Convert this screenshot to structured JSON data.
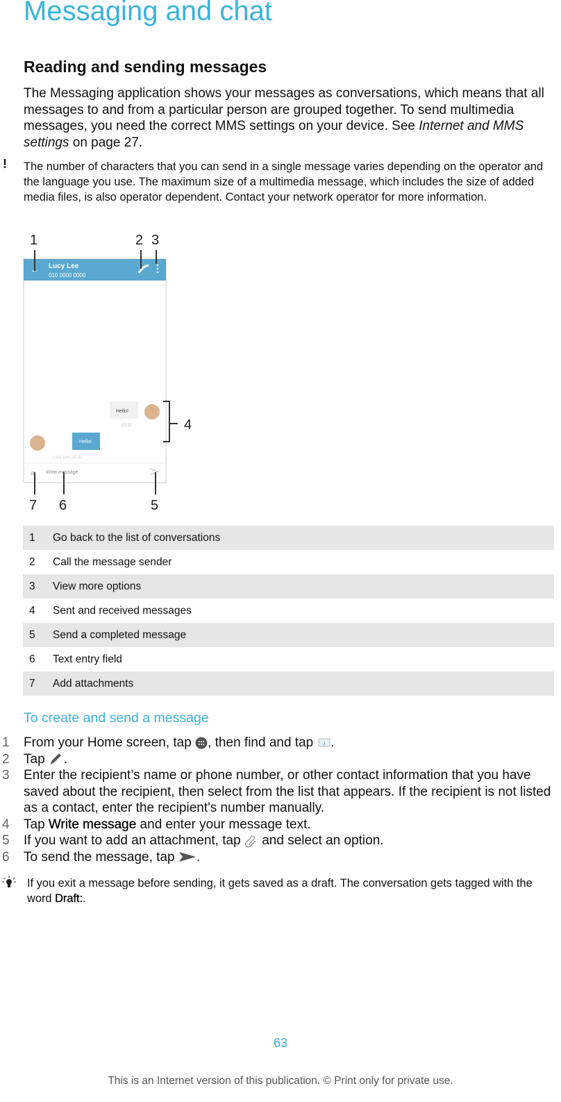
{
  "title": "Messaging and chat",
  "section": "Reading and sending messages",
  "intro": {
    "text1": "The Messaging application shows your messages as conversations, which means that all messages to and from a particular person are grouped together. To send multimedia messages, you need the correct MMS settings on your device. See ",
    "link": "Internet and MMS settings",
    "text2": " on page 27."
  },
  "note": "The number of characters that you can send in a single message varies depending on the operator and the language you use. The maximum size of a multimedia message, which includes the size of added media files, is also operator dependent. Contact your network operator for more information.",
  "figure": {
    "contact_name": "Lucy Lee",
    "contact_number": "010 0000 0000",
    "sent": "Hello!",
    "sent_time": "10:32",
    "received": "Hello!",
    "received_meta": "Lucy Lee, 10:32",
    "input_placeholder": "Write message",
    "callouts": [
      "1",
      "2",
      "3",
      "4",
      "5",
      "6",
      "7"
    ],
    "accent": "#5aa8cf"
  },
  "legend": [
    {
      "n": "1",
      "text": "Go back to the list of conversations"
    },
    {
      "n": "2",
      "text": "Call the message sender"
    },
    {
      "n": "3",
      "text": "View more options"
    },
    {
      "n": "4",
      "text": "Sent and received messages"
    },
    {
      "n": "5",
      "text": "Send a completed message"
    },
    {
      "n": "6",
      "text": "Text entry field"
    },
    {
      "n": "7",
      "text": "Add attachments"
    }
  ],
  "procedure": {
    "heading": "To create and send a message",
    "steps": [
      {
        "n": "1",
        "a": "From your Home screen, tap ",
        "b": ", then find and tap ",
        "c": "."
      },
      {
        "n": "2",
        "a": "Tap ",
        "c": "."
      },
      {
        "n": "3",
        "a": "Enter the recipient’s name or phone number, or other contact information that you have saved about the recipient, then select from the list that appears. If the recipient is not listed as a contact, enter the recipient's number manually."
      },
      {
        "n": "4",
        "a": "Tap ",
        "ui": "Write message",
        "c": " and enter your message text."
      },
      {
        "n": "5",
        "a": "If you want to add an attachment, tap ",
        "c": " and select an option."
      },
      {
        "n": "6",
        "a": "To send the message, tap ",
        "c": "."
      }
    ]
  },
  "tip": {
    "text": "If you exit a message before sending, it gets saved as a draft. The conversation gets tagged with the word ",
    "ui": "Draft:",
    "end": "."
  },
  "page_number": "63",
  "footer": "This is an Internet version of this publication. © Print only for private use."
}
